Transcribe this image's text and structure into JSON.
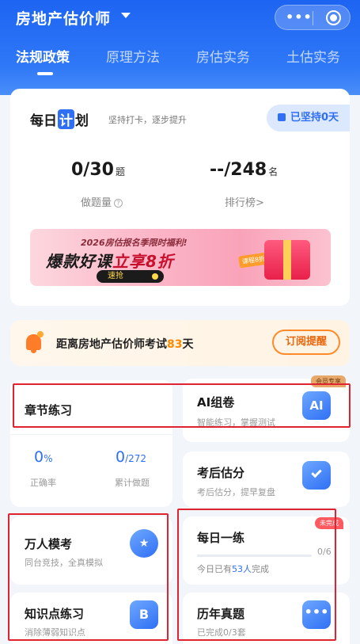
{
  "header": {
    "title": "房地产估价师"
  },
  "tabs": [
    {
      "label": "法规政策",
      "active": true
    },
    {
      "label": "原理方法",
      "active": false
    },
    {
      "label": "房估实务",
      "active": false
    },
    {
      "label": "土估实务",
      "active": false
    }
  ],
  "plan": {
    "title_a": "每日",
    "title_b": "计",
    "title_c": "划",
    "subtitle": "坚持打卡，逐步提升",
    "streak": "已坚持0天",
    "done_value": "0/30",
    "done_unit": "题",
    "done_label": "做题量",
    "rank_value": "--/248",
    "rank_unit": "名",
    "rank_label": "排行榜>"
  },
  "banner": {
    "line1": "2026房估报名季限时福利!",
    "line2a": "爆款好课",
    "line2b": "立享8折",
    "button": "速抢",
    "tag": "课程8折"
  },
  "exam": {
    "text": "距离房地产估价师考试",
    "days": "83",
    "unit": "天",
    "button": "订阅提醒"
  },
  "tiles": {
    "chapter": {
      "title": "章节练习",
      "accuracy_value": "0",
      "accuracy_unit": "%",
      "accuracy_label": "正确率",
      "count_value": "0",
      "count_total": "/272",
      "count_label": "累计做题"
    },
    "ai": {
      "title": "AI组卷",
      "sub": "智能练习，掌握测试",
      "badge": "会员专享",
      "icon_text": "AI"
    },
    "score": {
      "title": "考后估分",
      "sub": "考后估分，提早复盘"
    },
    "mock": {
      "title": "万人模考",
      "sub": "同台竞技，全真模拟"
    },
    "daily": {
      "title": "每日一练",
      "badge": "未完成",
      "progress": "0/6",
      "progress_value": 0,
      "people_prefix": "今日已有",
      "people_count": "53人",
      "people_suffix": "完成"
    },
    "knowledge": {
      "title": "知识点练习",
      "sub": "消除薄弱知识点"
    },
    "past": {
      "title": "历年真题",
      "sub": "已完成0/3套"
    }
  },
  "colors": {
    "primary": "#2f6ff5",
    "accent_orange": "#ff8a00",
    "highlight_red": "#e0232e"
  }
}
